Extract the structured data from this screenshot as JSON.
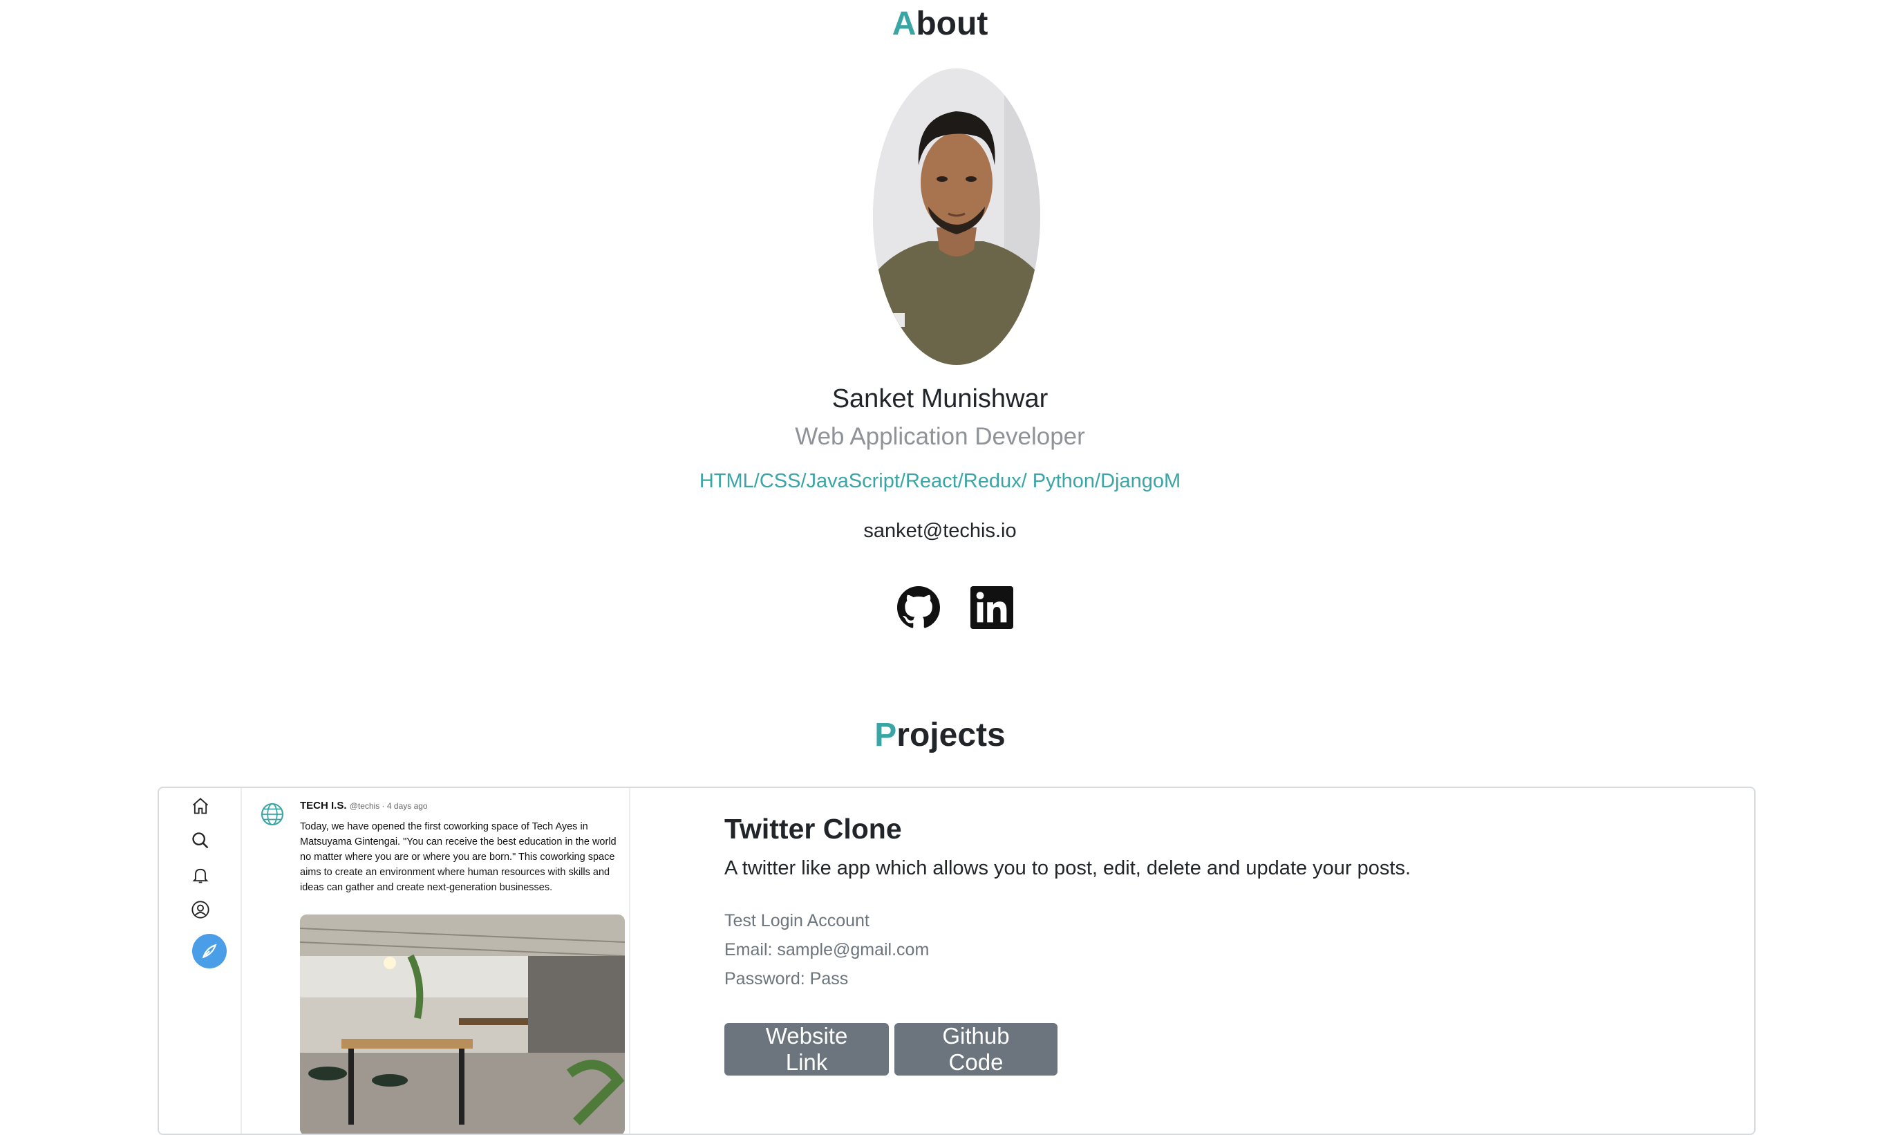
{
  "about": {
    "title_first": "A",
    "title_rest": "bout",
    "name": "Sanket Munishwar",
    "role": "Web Application Developer",
    "skills": "HTML/CSS/JavaScript/React/Redux/ Python/DjangoM",
    "email": "sanket@techis.io",
    "social": [
      {
        "icon": "github-icon"
      },
      {
        "icon": "linkedin-icon"
      }
    ]
  },
  "projects": {
    "title_first": "P",
    "title_rest": "rojects",
    "items": [
      {
        "screenshot": {
          "account_name": "TECH I.S.",
          "handle_time": "@techis · 4 days ago",
          "post_text": "Today, we have opened the first coworking space of Tech Ayes in Matsuyama Gintengai. \"You can receive the best education in the world no matter where you are or where you are born.\" This coworking space aims to create an environment where human resources with skills and ideas can gather and create next-generation businesses.",
          "nav_icons": [
            "home-icon",
            "search-icon",
            "bell-icon",
            "user-icon",
            "compose-icon"
          ]
        },
        "title": "Twitter Clone",
        "description": "A twitter like app which allows you to post, edit, delete and update your posts.",
        "credentials": {
          "heading": "Test Login Account",
          "email": "Email: sample@gmail.com",
          "password": "Password: Pass"
        },
        "buttons": {
          "website": "Website Link",
          "github": "Github Code"
        },
        "colors": {
          "accent": "#3aa5a5",
          "button_bg": "#6c757d",
          "compose_bg": "#4a9ee8"
        }
      }
    ]
  }
}
